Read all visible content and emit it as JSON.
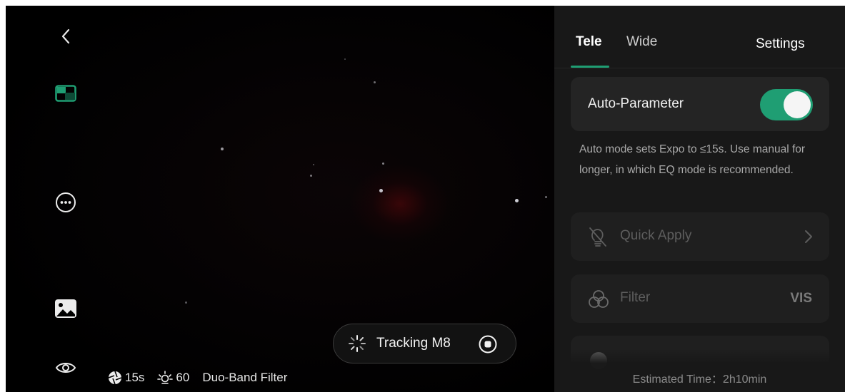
{
  "left_rail": {
    "back_icon": "chevron-left-icon",
    "layout_icon": "layout-icon",
    "more_icon": "more-icon",
    "gallery_icon": "gallery-icon",
    "eye_icon": "eye-icon"
  },
  "status": {
    "exposure": "15s",
    "gain": "60",
    "filter": "Duo-Band Filter",
    "exposure_icon": "aperture-icon",
    "gain_icon": "sun-icon"
  },
  "tracking": {
    "label": "Tracking M8",
    "spinner_icon": "spinner-icon",
    "stop_icon": "stop-icon"
  },
  "panel": {
    "tabs": {
      "tele": "Tele",
      "wide": "Wide",
      "settings": "Settings"
    },
    "active_tab": "Tele",
    "auto_parameter": {
      "label": "Auto-Parameter",
      "enabled": true
    },
    "auto_note": "Auto mode sets Expo to ≤15s. Use manual for longer, in which EQ mode is recommended.",
    "quick_apply": {
      "label": "Quick Apply",
      "icon": "bulb-off-icon"
    },
    "filter": {
      "label": "Filter",
      "value": "VIS",
      "icon": "filter-icon"
    },
    "shutter": {
      "icon": "shutter-icon"
    },
    "estimated_time": "Estimated Time：2h10min"
  },
  "colors": {
    "accent": "#1f9e73",
    "panel_bg": "#181818",
    "card_bg": "#242424"
  }
}
